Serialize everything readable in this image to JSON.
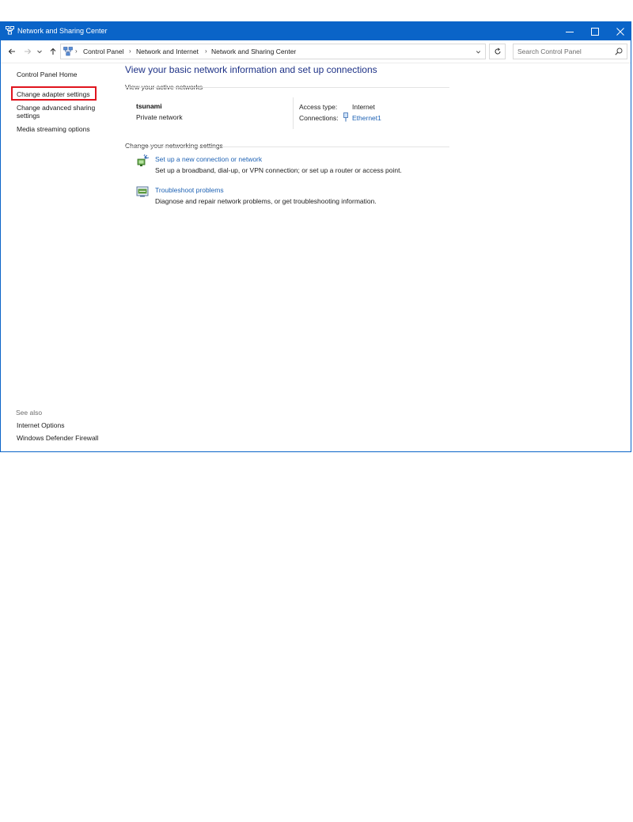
{
  "window": {
    "title": "Network and Sharing Center",
    "titlebar_color": "#0a64c8"
  },
  "titlebar_icons": [
    "minimize-icon",
    "maximize-icon",
    "close-icon"
  ],
  "address": {
    "crumbs": [
      "Control Panel",
      "Network and Internet",
      "Network and Sharing Center"
    ],
    "search_placeholder": "Search Control Panel"
  },
  "left_pane": {
    "links": [
      "Control Panel Home",
      "Change adapter settings",
      "Change advanced sharing",
      "settings",
      "Media streaming options"
    ],
    "highlighted": "Change adapter settings",
    "highlight_color": "#e0141e",
    "see_also_title": "See also",
    "see_also": [
      "Internet Options",
      "Windows Defender Firewall"
    ]
  },
  "main": {
    "heading": "View your basic network information and set up connections",
    "active_networks_label": "View your active networks",
    "network": {
      "name": "tsunami",
      "type": "Private network",
      "access_type_label": "Access type:",
      "access_type_value": "Internet",
      "connections_label": "Connections:",
      "connections_value": "Ethernet1"
    },
    "change_settings_label": "Change your networking settings",
    "tasks": [
      {
        "icon": "network-setup-icon",
        "title": "Set up a new connection or network",
        "description": "Set up a broadband, dial-up, or VPN connection; or set up a router or access point."
      },
      {
        "icon": "troubleshoot-icon",
        "title": "Troubleshoot problems",
        "description": "Diagnose and repair network problems, or get troubleshooting information."
      }
    ]
  },
  "colors": {
    "link": "#1e62b4",
    "heading": "#1e3287"
  }
}
